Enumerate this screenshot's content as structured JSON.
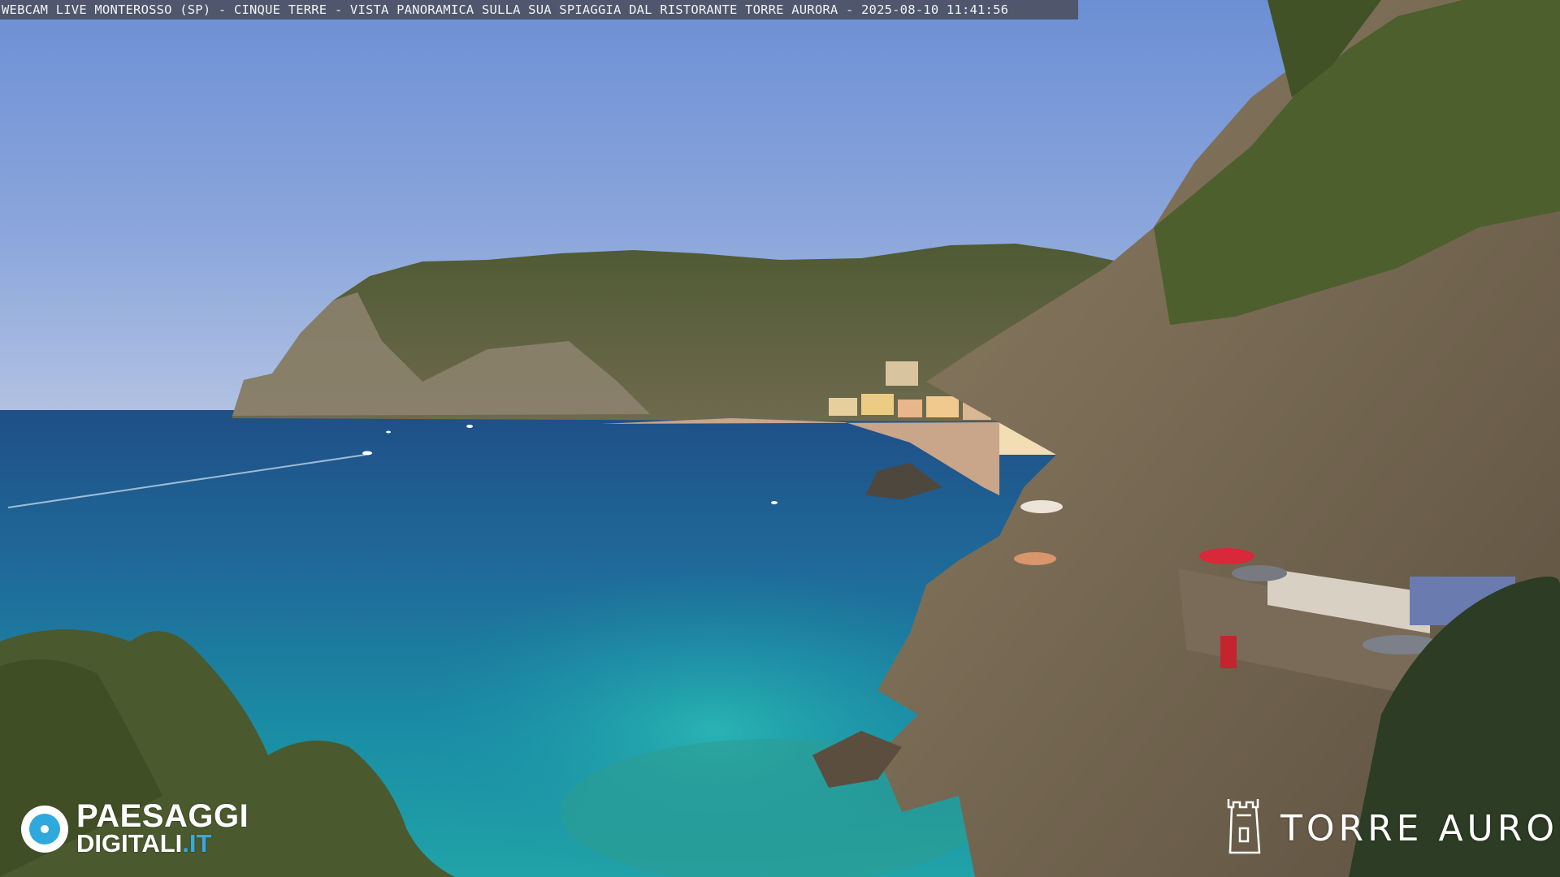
{
  "caption": {
    "text": "WEBCAM LIVE MONTEROSSO (SP) - CINQUE TERRE - VISTA PANORAMICA SULLA SUA SPIAGGIA DAL RISTORANTE TORRE AURORA - 2025-08-10 11:41:56"
  },
  "watermark_left": {
    "line1": "PAESAGGI",
    "line2_main": "DIGITALI",
    "line2_tld": ".IT",
    "accent_color": "#2fa8dc"
  },
  "watermark_right": {
    "name": "TORRE AURORA",
    "icon": "tower-icon"
  }
}
